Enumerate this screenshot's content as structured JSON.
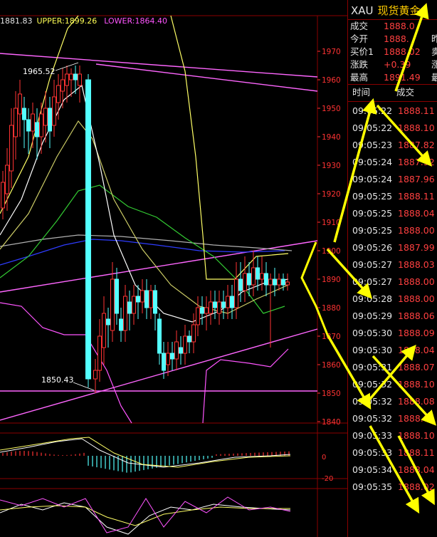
{
  "indicator_legend": {
    "mid": "1881.83",
    "upper": "UPPER:1899.26",
    "lower": "LOWER:1864.40"
  },
  "colors": {
    "up_candle": "#ff3333",
    "down_candle": "#54ffff",
    "price_axis": "#ff3333",
    "arrow": "#ffff00",
    "upper_band": "#ffff66",
    "lower_band": "#ff55ff",
    "ma_blue": "#2e3cff",
    "ma_green": "#33cc33"
  },
  "chart_data": {
    "type": "candlestick",
    "y_axis_labels": [
      "1970",
      "1960",
      "1950",
      "1940",
      "1930",
      "1920",
      "1910",
      "1900",
      "1890",
      "1880",
      "1870",
      "1860",
      "1850",
      "1840"
    ],
    "annotations": [
      "1965.52",
      "1850.43"
    ],
    "macd_axis_labels": [
      "0",
      "-20"
    ]
  },
  "quote": {
    "symbol": "XAU",
    "name": "现货黄金",
    "rows": [
      {
        "label": "成交",
        "value": "1888.0",
        "extra": ""
      },
      {
        "label": "今开",
        "value": "1888.",
        "extra": "昨"
      },
      {
        "label": "买价1",
        "value": "1888.02",
        "extra": "卖"
      },
      {
        "label": "涨跌",
        "value": "+0.39",
        "extra": "涨"
      },
      {
        "label": "最高",
        "value": "1891.49",
        "extra": "最"
      }
    ],
    "ticks_header": {
      "time": "时间",
      "price": "成交"
    },
    "ticks": [
      {
        "time": "09:05:22",
        "price": "1888.11"
      },
      {
        "time": "09:05:22",
        "price": "1888.10"
      },
      {
        "time": "09:05:23",
        "price": "1887.82"
      },
      {
        "time": "09:05:24",
        "price": "1887.92"
      },
      {
        "time": "09:05:24",
        "price": "1887.96"
      },
      {
        "time": "09:05:25",
        "price": "1888.11"
      },
      {
        "time": "09:05:25",
        "price": "1888.04"
      },
      {
        "time": "09:05:25",
        "price": "1888.00"
      },
      {
        "time": "09:05:26",
        "price": "1887.99"
      },
      {
        "time": "09:05:27",
        "price": "1888.03"
      },
      {
        "time": "09:05:27",
        "price": "1888.00"
      },
      {
        "time": "09:05:28",
        "price": "1888.00"
      },
      {
        "time": "09:05:29",
        "price": "1888.06"
      },
      {
        "time": "09:05:30",
        "price": "1888.09"
      },
      {
        "time": "09:05:30",
        "price": "1888.04"
      },
      {
        "time": "09:05:31",
        "price": "1888.07"
      },
      {
        "time": "09:05:32",
        "price": "1888.10"
      },
      {
        "time": "09:05:32",
        "price": "1888.08"
      },
      {
        "time": "09:05:32",
        "price": "1888.05"
      },
      {
        "time": "09:05:33",
        "price": "1888.10"
      },
      {
        "time": "09:05:33",
        "price": "1888.11"
      },
      {
        "time": "09:05:34",
        "price": "1888.04"
      },
      {
        "time": "09:05:35",
        "price": "1888.02"
      }
    ]
  }
}
